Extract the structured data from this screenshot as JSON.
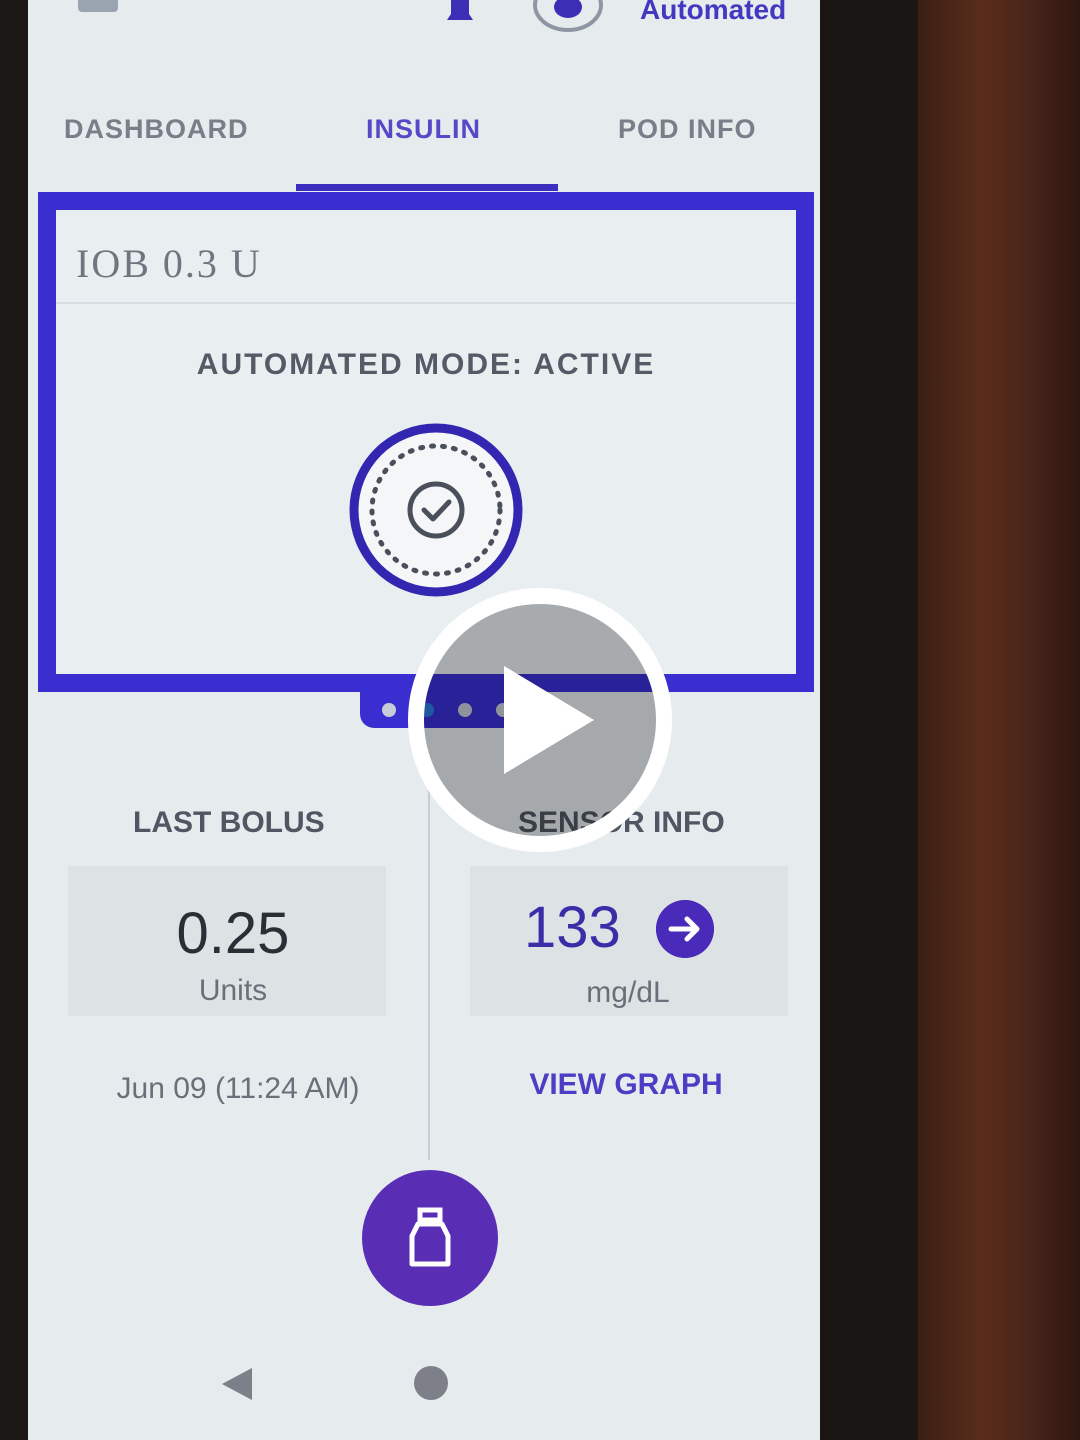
{
  "header": {
    "mode_label": "Automated"
  },
  "tabs": [
    {
      "label": "DASHBOARD"
    },
    {
      "label": "INSULIN"
    },
    {
      "label": "POD INFO"
    }
  ],
  "card": {
    "iob": "IOB 0.3 U",
    "status": "AUTOMATED MODE: ACTIVE"
  },
  "last_bolus": {
    "title": "LAST BOLUS",
    "value": "0.25",
    "unit": "Units",
    "date": "Jun 09 (11:24 AM)"
  },
  "sensor_info": {
    "title": "SENSOR INFO",
    "value": "133",
    "unit": "mg/dL",
    "link": "VIEW GRAPH"
  },
  "icons": {
    "menu": "menu-icon",
    "notifications": "bell-icon",
    "mode": "automated-mode-icon",
    "status": "check-circle-icon",
    "sensor_arrow": "arrow-right-icon",
    "fab": "insulin-vial-icon",
    "back": "back-triangle-icon",
    "home": "home-circle-icon",
    "play": "play-icon"
  },
  "colors": {
    "accent": "#3a2ed1",
    "fab": "#5a2db5",
    "glucose": "#3a2ea8"
  }
}
